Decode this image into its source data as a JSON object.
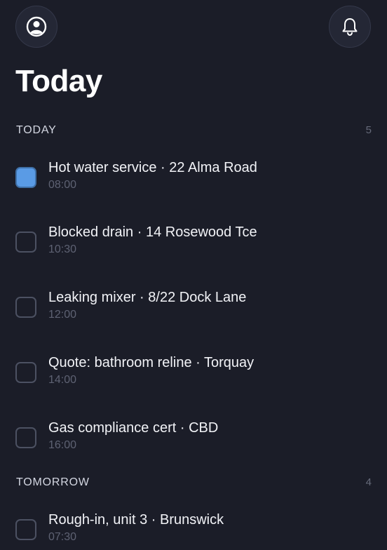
{
  "header": {
    "profile_icon": "user-circle-icon",
    "notifications_icon": "bell-icon",
    "title": "Today"
  },
  "sections": [
    {
      "label": "TODAY",
      "count": "5",
      "tasks": [
        {
          "title": "Hot water service · 22 Alma Road",
          "time": "08:00",
          "checked": true
        },
        {
          "title": "Blocked drain · 14 Rosewood Tce",
          "time": "10:30",
          "checked": false
        },
        {
          "title": "Leaking mixer · 8/22 Dock Lane",
          "time": "12:00",
          "checked": false
        },
        {
          "title": "Quote: bathroom reline · Torquay",
          "time": "14:00",
          "checked": false
        },
        {
          "title": "Gas compliance cert · CBD",
          "time": "16:00",
          "checked": false
        }
      ]
    },
    {
      "label": "TOMORROW",
      "count": "4",
      "tasks": [
        {
          "title": "Rough-in, unit 3 · Brunswick",
          "time": "07:30",
          "checked": false
        }
      ]
    }
  ],
  "colors": {
    "background": "#1b1d28",
    "accent": "#5a9be5"
  }
}
